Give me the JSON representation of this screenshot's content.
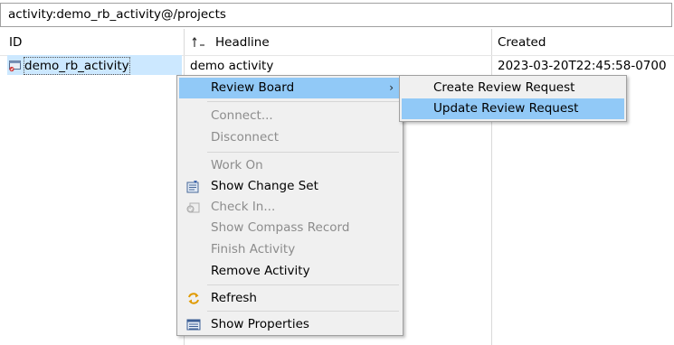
{
  "pathbar": {
    "text": "activity:demo_rb_activity@/projects"
  },
  "table": {
    "columns": [
      "ID",
      "Headline",
      "Created"
    ],
    "rows": [
      {
        "id": "demo_rb_activity",
        "headline": "demo activity",
        "created": "2023-03-20T22:45:58-0700"
      }
    ]
  },
  "context_menu": {
    "items": [
      {
        "label": "Review Board",
        "enabled": true,
        "highlighted": true,
        "submenu": true
      },
      {
        "label": "Connect...",
        "enabled": false
      },
      {
        "label": "Disconnect",
        "enabled": false
      },
      {
        "label": "Work On",
        "enabled": false
      },
      {
        "label": "Show Change Set",
        "enabled": true,
        "icon": "change-set-icon"
      },
      {
        "label": "Check In...",
        "enabled": false,
        "icon": "check-in-icon"
      },
      {
        "label": "Show Compass Record",
        "enabled": false
      },
      {
        "label": "Finish Activity",
        "enabled": false
      },
      {
        "label": "Remove Activity",
        "enabled": true
      },
      {
        "label": "Refresh",
        "enabled": true,
        "icon": "refresh-icon"
      },
      {
        "label": "Show Properties",
        "enabled": true,
        "icon": "properties-icon"
      }
    ]
  },
  "submenu": {
    "items": [
      {
        "label": "Create Review Request",
        "highlighted": false
      },
      {
        "label": "Update Review Request",
        "highlighted": true
      }
    ]
  },
  "colors": {
    "selection": "#cce8ff",
    "menu_highlight": "#91c9f7",
    "menu_background": "#f0f0f0",
    "disabled_text": "#8c8c8c"
  }
}
